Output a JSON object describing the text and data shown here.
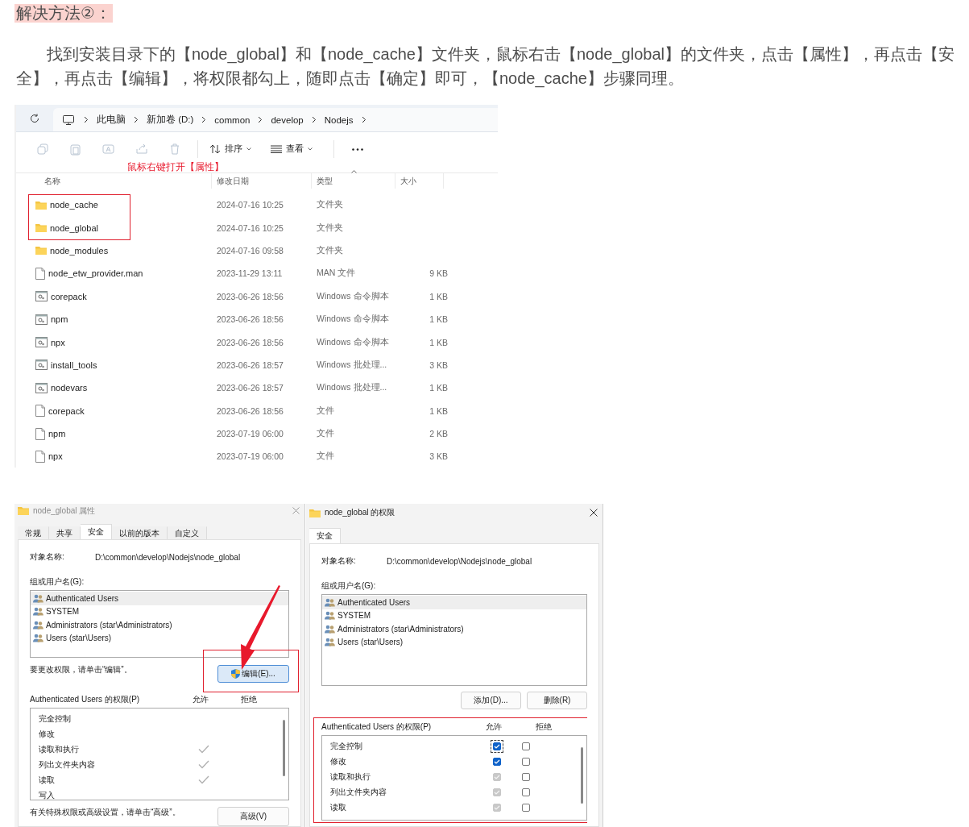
{
  "heading": "解决方法②：",
  "paragraph": "找到安装目录下的【node_global】和【node_cache】文件夹，鼠标右击【node_global】的文件夹，点击【属性】，再点击【安全】，再点击【编辑】，将权限都勾上，随即点击【确定】即可，【node_cache】步骤同理。",
  "explorer": {
    "breadcrumb": [
      "此电脑",
      "新加卷 (D:)",
      "common",
      "develop",
      "Nodejs"
    ],
    "sort_label": "排序",
    "view_label": "查看",
    "annotation": "鼠标右键打开【属性】",
    "columns": [
      "名称",
      "修改日期",
      "类型",
      "大小"
    ],
    "rows": [
      {
        "kind": "folder",
        "name": "node_cache",
        "date": "2024-07-16 10:25",
        "type": "文件夹",
        "highlighted": true
      },
      {
        "kind": "folder",
        "name": "node_global",
        "date": "2024-07-16 10:25",
        "type": "文件夹",
        "highlighted": true
      },
      {
        "kind": "folder",
        "name": "node_modules",
        "date": "2024-07-16 09:58",
        "type": "文件夹",
        "highlighted": false
      },
      {
        "kind": "file",
        "name": "node_etw_provider.man",
        "date": "2023-11-29 13:11",
        "type": "MAN 文件",
        "size": "9 KB",
        "highlighted": false
      },
      {
        "kind": "script",
        "name": "corepack",
        "date": "2023-06-26 18:56",
        "type": "Windows 命令脚本",
        "size": "1 KB",
        "highlighted": false
      },
      {
        "kind": "script",
        "name": "npm",
        "date": "2023-06-26 18:56",
        "type": "Windows 命令脚本",
        "size": "1 KB",
        "highlighted": false
      },
      {
        "kind": "script",
        "name": "npx",
        "date": "2023-06-26 18:56",
        "type": "Windows 命令脚本",
        "size": "1 KB",
        "highlighted": false
      },
      {
        "kind": "script",
        "name": "install_tools",
        "date": "2023-06-26 18:57",
        "type": "Windows 批处理...",
        "size": "3 KB",
        "highlighted": false
      },
      {
        "kind": "script",
        "name": "nodevars",
        "date": "2023-06-26 18:57",
        "type": "Windows 批处理...",
        "size": "1 KB",
        "highlighted": false
      },
      {
        "kind": "file",
        "name": "corepack",
        "date": "2023-06-26 18:56",
        "type": "文件",
        "size": "1 KB",
        "highlighted": false
      },
      {
        "kind": "file",
        "name": "npm",
        "date": "2023-07-19 06:00",
        "type": "文件",
        "size": "2 KB",
        "highlighted": false
      },
      {
        "kind": "file",
        "name": "npx",
        "date": "2023-07-19 06:00",
        "type": "文件",
        "size": "3 KB",
        "highlighted": false
      }
    ]
  },
  "properties_dialog": {
    "title": "node_global 属性",
    "tabs": [
      {
        "label": "常规",
        "selected": false
      },
      {
        "label": "共享",
        "selected": false
      },
      {
        "label": "安全",
        "selected": true
      },
      {
        "label": "以前的版本",
        "selected": false
      },
      {
        "label": "自定义",
        "selected": false
      }
    ],
    "object_label": "对象名称:",
    "object_path": "D:\\common\\develop\\Nodejs\\node_global",
    "group_label": "组或用户名(G):",
    "users": [
      {
        "name": "Authenticated Users",
        "selected": true
      },
      {
        "name": "SYSTEM",
        "selected": false
      },
      {
        "name": "Administrators (star\\Administrators)",
        "selected": false
      },
      {
        "name": "Users (star\\Users)",
        "selected": false
      }
    ],
    "edit_hint": "要更改权限，请单击“编辑”。",
    "edit_button": "编辑(E)...",
    "edit_highlighted": true,
    "permissions_label": "Authenticated Users 的权限(P)",
    "allow_header": "允许",
    "deny_header": "拒绝",
    "permissions": [
      {
        "label": "完全控制",
        "allow": false
      },
      {
        "label": "修改",
        "allow": false
      },
      {
        "label": "读取和执行",
        "allow": true
      },
      {
        "label": "列出文件夹内容",
        "allow": true
      },
      {
        "label": "读取",
        "allow": true
      },
      {
        "label": "写入",
        "allow": false
      }
    ],
    "footer_hint": "有关特殊权限或高级设置，请单击“高级”。",
    "advanced_button": "高级(V)"
  },
  "permissions_dialog": {
    "title": "node_global 的权限",
    "tabs": [
      {
        "label": "安全",
        "selected": true
      }
    ],
    "object_label": "对象名称:",
    "object_path": "D:\\common\\develop\\Nodejs\\node_global",
    "group_label": "组或用户名(G):",
    "users": [
      {
        "name": "Authenticated Users",
        "selected": true
      },
      {
        "name": "SYSTEM",
        "selected": false
      },
      {
        "name": "Administrators (star\\Administrators)",
        "selected": false
      },
      {
        "name": "Users (star\\Users)",
        "selected": false
      }
    ],
    "add_button": "添加(D)...",
    "remove_button": "删除(R)",
    "permissions_highlighted": true,
    "permissions_label": "Authenticated Users 的权限(P)",
    "allow_header": "允许",
    "deny_header": "拒绝",
    "permissions": [
      {
        "label": "完全控制",
        "allow": true,
        "locked": false,
        "deny": false,
        "focused": true
      },
      {
        "label": "修改",
        "allow": true,
        "locked": false,
        "deny": false,
        "focused": false
      },
      {
        "label": "读取和执行",
        "allow": true,
        "locked": true,
        "deny": false,
        "focused": false
      },
      {
        "label": "列出文件夹内容",
        "allow": true,
        "locked": true,
        "deny": false,
        "focused": false
      },
      {
        "label": "读取",
        "allow": true,
        "locked": true,
        "deny": false,
        "focused": false
      }
    ]
  }
}
